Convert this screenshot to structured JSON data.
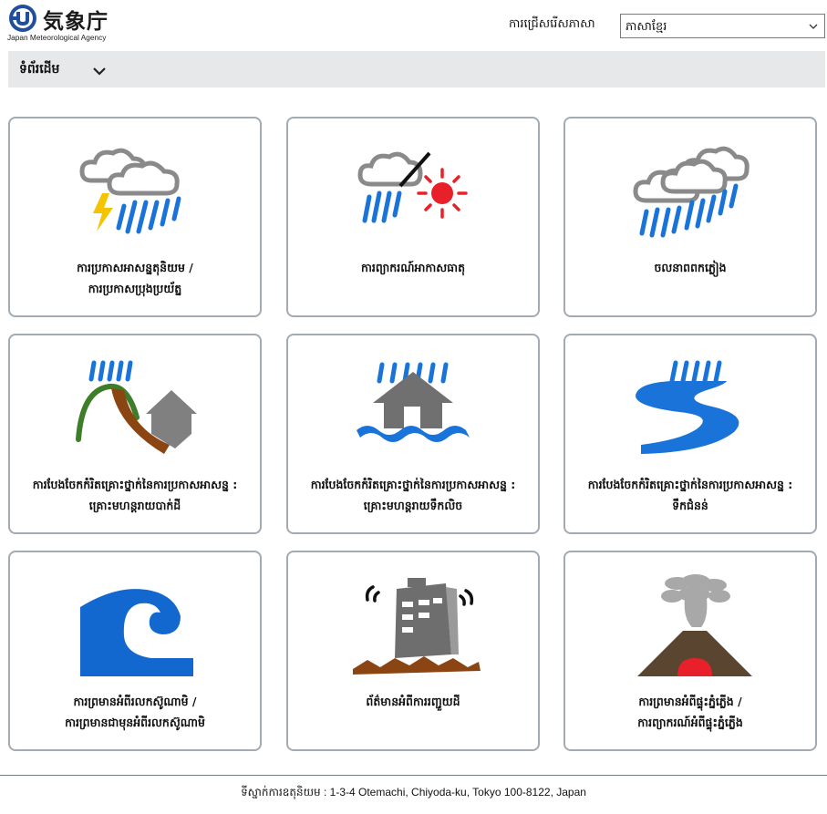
{
  "header": {
    "logo_jp": "気象庁",
    "logo_en": "Japan Meteorological Agency",
    "language_label": "ការជ្រើសរើសភាសា",
    "language_selected": "ភាសាខ្មែរ"
  },
  "nav": {
    "home_label": "ទំព័រដើម"
  },
  "cards": [
    {
      "icon": "thunderstorm-icon",
      "line1": "ការប្រកាសអាសន្នតុនិយម /",
      "line2": "ការប្រកាសប្រុងប្រយ័ត្ន"
    },
    {
      "icon": "weather-forecast-icon",
      "line1": "ការព្យាករណ៍អាកាសធាតុ",
      "line2": ""
    },
    {
      "icon": "heavy-rain-icon",
      "line1": "ចលនាពពកភ្លៀង",
      "line2": ""
    },
    {
      "icon": "landslide-icon",
      "line1": "ការបែងចែកកំរិតគ្រោះថ្នាក់នៃការប្រកាសអាសន្ន :",
      "line2": "គ្រោះមហន្តរាយបាក់ដី"
    },
    {
      "icon": "flood-house-icon",
      "line1": "ការបែងចែកកំរិតគ្រោះថ្នាក់នៃការប្រកាសអាសន្ន :",
      "line2": "គ្រោះមហន្តរាយទឹកលិច"
    },
    {
      "icon": "river-flood-icon",
      "line1": "ការបែងចែកកំរិតគ្រោះថ្នាក់នៃការប្រកាសអាសន្ន :",
      "line2": "ទឹកជំនន់"
    },
    {
      "icon": "tsunami-wave-icon",
      "line1": "ការព្រមានអំពីរលកស៊ូណាមិ /",
      "line2": "ការព្រមានជាមុនអំពីរលកស៊ូណាមិ"
    },
    {
      "icon": "earthquake-building-icon",
      "line1": "ព័ត៌មានអំពីការរញ្ជួយដី",
      "line2": ""
    },
    {
      "icon": "volcano-icon",
      "line1": "ការព្រមានអំពីផ្ទុះភ្នំភ្លើង /",
      "line2": "ការព្យាករណ៍អំពីផ្ទុះភ្នំភ្លើង"
    }
  ],
  "footer": {
    "address": "ទីស្នាក់ការឧតុនិយម : 1-3-4 Otemachi, Chiyoda-ku, Tokyo 100-8122, Japan"
  },
  "colors": {
    "rain_blue": "#1a73d9",
    "cloud_gray": "#8a8a8a",
    "lightning_yellow": "#f5c400",
    "sun_red": "#e8202a",
    "earth_brown": "#8b4513",
    "volcano_dark": "#5a4630",
    "border": "#a3aab1",
    "nav_bg": "#e6e8ea"
  }
}
